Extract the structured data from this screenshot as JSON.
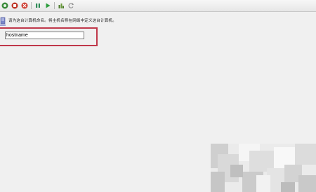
{
  "toolbar": {
    "buttons": [
      {
        "icon": "back-arrow-icon",
        "color": "#3a8a3a"
      },
      {
        "icon": "stop-icon",
        "color": "#c0392b"
      },
      {
        "icon": "cancel-icon",
        "color": "#d0453a"
      },
      {
        "icon": "pause-icon",
        "color": "#2e8b57"
      },
      {
        "icon": "play-icon",
        "color": "#2e9e3e"
      },
      {
        "icon": "save-icon",
        "color": "#4a7a2a"
      },
      {
        "icon": "refresh-icon",
        "color": "#888888"
      }
    ]
  },
  "main": {
    "prompt": "请为这台计算机命名。将主机名称在网络中定义这台计算机。",
    "hostname_value": "hostname",
    "highlight_color": "#c0384a"
  }
}
